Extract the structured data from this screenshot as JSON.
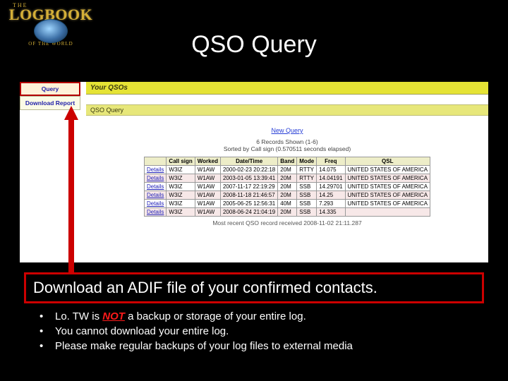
{
  "logo": {
    "the": "THE",
    "logbook": "LOGBOOK",
    "ofworld": "OF THE WORLD"
  },
  "title": "QSO Query",
  "sidebar": {
    "items": [
      {
        "label": "Query"
      },
      {
        "label": "Download Report"
      }
    ]
  },
  "pane": {
    "heading": "Your QSOs",
    "subheading": "QSO Query",
    "new_query": "New Query",
    "records_shown": "6 Records Shown (1-6)",
    "sorted_by": "Sorted by Call sign (0.570511 seconds elapsed)",
    "most_recent": "Most recent QSO record received 2008-11-02 21:11.287"
  },
  "table": {
    "headers": [
      "",
      "Call sign",
      "Worked",
      "Date/Time",
      "Band",
      "Mode",
      "Freq",
      "QSL"
    ],
    "rows": [
      {
        "details": "Details",
        "call": "W3IZ",
        "worked": "W1AW",
        "datetime": "2000-02-23 20:22:18",
        "band": "20M",
        "mode": "RTTY",
        "freq": "14.075",
        "qsl": "UNITED STATES OF AMERICA"
      },
      {
        "details": "Details",
        "call": "W3IZ",
        "worked": "W1AW",
        "datetime": "2003-01-05 13:39:41",
        "band": "20M",
        "mode": "RTTY",
        "freq": "14.04191",
        "qsl": "UNITED STATES OF AMERICA"
      },
      {
        "details": "Details",
        "call": "W3IZ",
        "worked": "W1AW",
        "datetime": "2007-11-17 22:19:29",
        "band": "20M",
        "mode": "SSB",
        "freq": "14.29701",
        "qsl": "UNITED STATES OF AMERICA"
      },
      {
        "details": "Details",
        "call": "W3IZ",
        "worked": "W1AW",
        "datetime": "2008-11-18 21:46:57",
        "band": "20M",
        "mode": "SSB",
        "freq": "14.25",
        "qsl": "UNITED STATES OF AMERICA"
      },
      {
        "details": "Details",
        "call": "W3IZ",
        "worked": "W1AW",
        "datetime": "2005-06-25 12:56:31",
        "band": "40M",
        "mode": "SSB",
        "freq": "7.293",
        "qsl": "UNITED STATES OF AMERICA"
      },
      {
        "details": "Details",
        "call": "W3IZ",
        "worked": "W1AW",
        "datetime": "2008-06-24 21:04:19",
        "band": "20M",
        "mode": "SSB",
        "freq": "14.335",
        "qsl": ""
      }
    ]
  },
  "banner": "Download an ADIF file of your confirmed contacts.",
  "bullets": {
    "b1_pre": "Lo. TW is ",
    "b1_not": "NOT",
    "b1_post": " a backup or storage of your entire log.",
    "b2": "You cannot download your entire log.",
    "b3": "Please make regular backups of your log files to external media"
  }
}
